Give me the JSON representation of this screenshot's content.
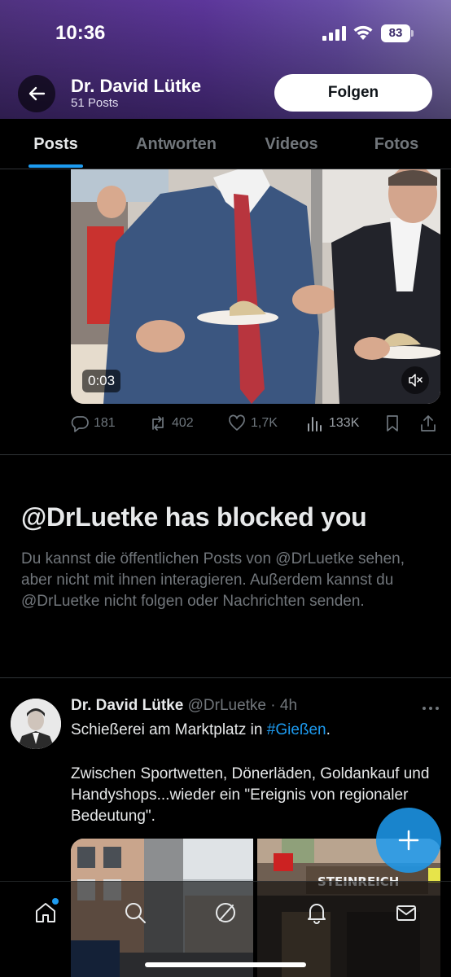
{
  "status_bar": {
    "time": "10:36",
    "battery": "83"
  },
  "profile": {
    "name": "Dr. David Lütke",
    "post_count": "51 Posts",
    "follow_label": "Folgen"
  },
  "tabs": [
    {
      "label": "Posts",
      "active": true
    },
    {
      "label": "Antworten",
      "active": false
    },
    {
      "label": "Videos",
      "active": false
    },
    {
      "label": "Fotos",
      "active": false
    }
  ],
  "video_post": {
    "duration": "0:03",
    "replies": "181",
    "reposts": "402",
    "likes": "1,7K",
    "views": "133K"
  },
  "blocked_notice": {
    "title": "@DrLuetke has blocked you",
    "text": "Du kannst die öffentlichen Posts von @DrLuetke sehen, aber nicht mit ihnen interagieren. Außerdem kannst du @DrLuetke nicht folgen oder Nachrichten senden."
  },
  "tweet": {
    "name": "Dr. David Lütke",
    "handle": "@DrLuetke",
    "time": "· 4h",
    "line1_prefix": "Schießerei am Marktplatz in ",
    "hashtag": "#Gießen",
    "line1_suffix": ".",
    "paragraph2": "Zwischen Sportwetten, Dönerläden, Goldankauf und Handyshops...wieder ein \"Ereignis von regionaler Bedeutung\".",
    "photo_sign": "STEINREICH"
  },
  "colors": {
    "accent": "#1d9bf0",
    "muted": "#71767b",
    "text": "#e7e9ea",
    "background": "#000000"
  },
  "icons": [
    "back-arrow-icon",
    "reply-icon",
    "repost-icon",
    "like-icon",
    "views-icon",
    "bookmark-icon",
    "share-icon",
    "mute-icon",
    "more-icon",
    "compose-icon",
    "home-icon",
    "search-icon",
    "grok-icon",
    "notifications-icon",
    "messages-icon"
  ]
}
